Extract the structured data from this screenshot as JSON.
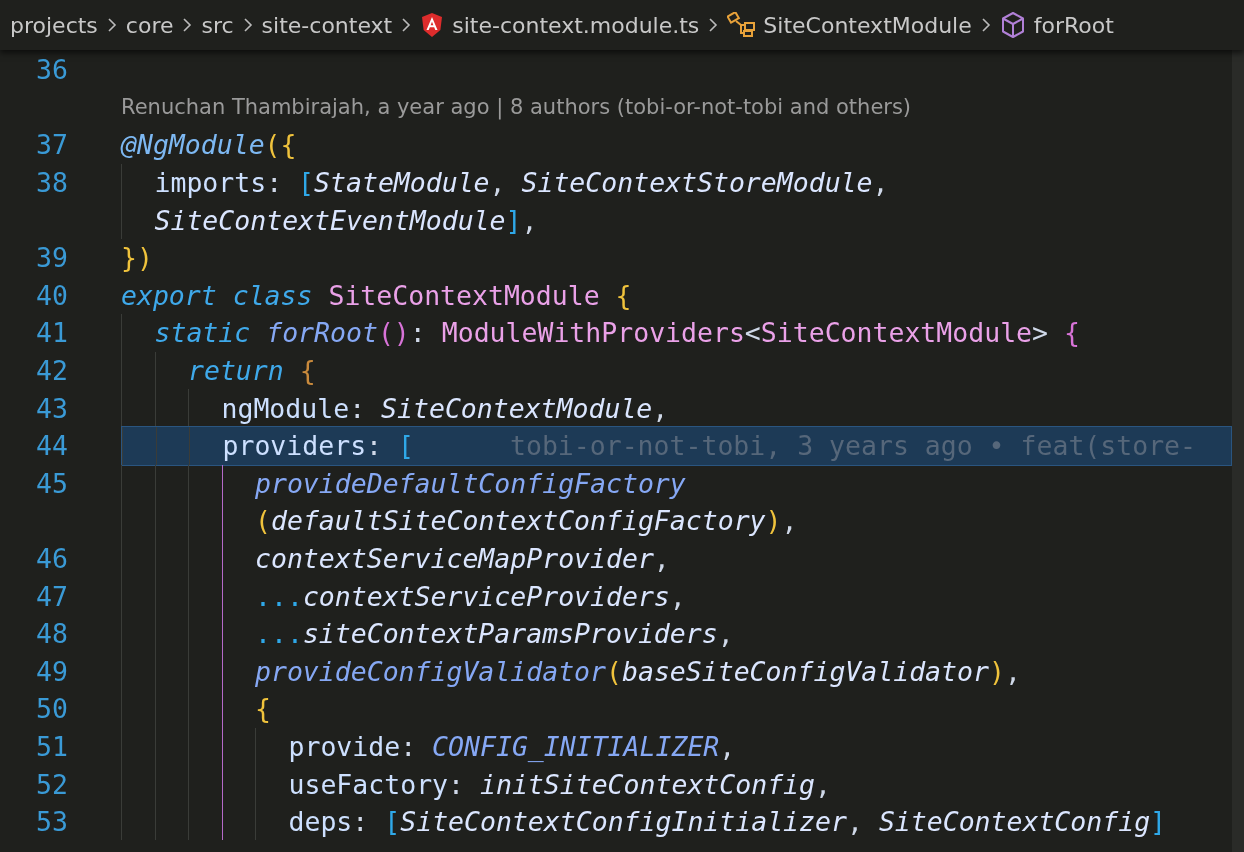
{
  "breadcrumb": [
    {
      "label": "projects",
      "kind": "folder"
    },
    {
      "label": "core",
      "kind": "folder"
    },
    {
      "label": "src",
      "kind": "folder"
    },
    {
      "label": "site-context",
      "kind": "folder"
    },
    {
      "label": "site-context.module.ts",
      "kind": "file"
    },
    {
      "label": "SiteContextModule",
      "kind": "class"
    },
    {
      "label": "forRoot",
      "kind": "method"
    }
  ],
  "lines": [
    {
      "number": "36"
    },
    {
      "kind": "codelens",
      "text": "Renuchan Thambirajah, a year ago | 8 authors (tobi-or-not-tobi and others)"
    },
    {
      "number": "37",
      "tokens": [
        {
          "text": "@NgModule",
          "kind": "deco"
        },
        {
          "text": "({",
          "kind": "br1"
        }
      ],
      "children": [
        {
          "number": "38",
          "tokens": [
            {
              "text": "imports",
              "kind": "prop"
            },
            {
              "text": ": ",
              "kind": "punc"
            },
            {
              "text": "[",
              "kind": "br3"
            },
            {
              "text": "StateModule",
              "kind": "id"
            },
            {
              "text": ", ",
              "kind": "punc"
            },
            {
              "text": "SiteContextStoreModule",
              "kind": "id"
            },
            {
              "text": ",",
              "kind": "punc"
            }
          ],
          "wrap": [
            {
              "text": "SiteContextEventModule",
              "kind": "id"
            },
            {
              "text": "]",
              "kind": "br3"
            },
            {
              "text": ",",
              "kind": "punc"
            }
          ]
        }
      ]
    },
    {
      "number": "39",
      "tokens": [
        {
          "text": "})",
          "kind": "br1"
        }
      ]
    },
    {
      "number": "40",
      "tokens": [
        {
          "text": "export class ",
          "kind": "kw"
        },
        {
          "text": "SiteContextModule",
          "kind": "cls"
        },
        {
          "text": " {",
          "kind": "br1"
        }
      ],
      "children": [
        {
          "number": "41",
          "tokens": [
            {
              "text": "static ",
              "kind": "kw"
            },
            {
              "text": "forRoot",
              "kind": "fn"
            },
            {
              "text": "()",
              "kind": "br2"
            },
            {
              "text": ": ",
              "kind": "punc"
            },
            {
              "text": "ModuleWithProviders",
              "kind": "cls"
            },
            {
              "text": "<",
              "kind": "punc"
            },
            {
              "text": "SiteContextModule",
              "kind": "cls"
            },
            {
              "text": "> ",
              "kind": "punc"
            },
            {
              "text": "{",
              "kind": "br2"
            }
          ],
          "children": [
            {
              "number": "42",
              "tokens": [
                {
                  "text": "return ",
                  "kind": "kw"
                },
                {
                  "text": "{",
                  "kind": "br4"
                }
              ],
              "children": [
                {
                  "number": "43",
                  "tokens": [
                    {
                      "text": "ngModule",
                      "kind": "prop"
                    },
                    {
                      "text": ": ",
                      "kind": "punc"
                    },
                    {
                      "text": "SiteContextModule",
                      "kind": "id"
                    },
                    {
                      "text": ",",
                      "kind": "punc"
                    }
                  ]
                },
                {
                  "number": "44",
                  "current": true,
                  "blame": "tobi-or-not-tobi, 3 years ago • feat(store-",
                  "tokens": [
                    {
                      "text": "providers",
                      "kind": "prop"
                    },
                    {
                      "text": ": ",
                      "kind": "punc"
                    },
                    {
                      "text": "[",
                      "kind": "br3"
                    }
                  ],
                  "children": [
                    {
                      "number": "45",
                      "tokens": [
                        {
                          "text": "provideDefaultConfigFactory",
                          "kind": "fn"
                        }
                      ],
                      "wrap": [
                        {
                          "text": "(",
                          "kind": "br1"
                        },
                        {
                          "text": "defaultSiteContextConfigFactory",
                          "kind": "id"
                        },
                        {
                          "text": ")",
                          "kind": "br1"
                        },
                        {
                          "text": ",",
                          "kind": "punc"
                        }
                      ]
                    },
                    {
                      "number": "46",
                      "tokens": [
                        {
                          "text": "contextServiceMapProvider",
                          "kind": "id"
                        },
                        {
                          "text": ",",
                          "kind": "punc"
                        }
                      ]
                    },
                    {
                      "number": "47",
                      "tokens": [
                        {
                          "text": "...",
                          "kind": "br3"
                        },
                        {
                          "text": "contextServiceProviders",
                          "kind": "id"
                        },
                        {
                          "text": ",",
                          "kind": "punc"
                        }
                      ]
                    },
                    {
                      "number": "48",
                      "tokens": [
                        {
                          "text": "...",
                          "kind": "br3"
                        },
                        {
                          "text": "siteContextParamsProviders",
                          "kind": "id"
                        },
                        {
                          "text": ",",
                          "kind": "punc"
                        }
                      ]
                    },
                    {
                      "number": "49",
                      "tokens": [
                        {
                          "text": "provideConfigValidator",
                          "kind": "fn"
                        },
                        {
                          "text": "(",
                          "kind": "br1"
                        },
                        {
                          "text": "baseSiteConfigValidator",
                          "kind": "id"
                        },
                        {
                          "text": ")",
                          "kind": "br1"
                        },
                        {
                          "text": ",",
                          "kind": "punc"
                        }
                      ]
                    },
                    {
                      "number": "50",
                      "tokens": [
                        {
                          "text": "{",
                          "kind": "br1"
                        }
                      ],
                      "children": [
                        {
                          "number": "51",
                          "tokens": [
                            {
                              "text": "provide",
                              "kind": "prop"
                            },
                            {
                              "text": ": ",
                              "kind": "punc"
                            },
                            {
                              "text": "CONFIG_INITIALIZER",
                              "kind": "fn"
                            },
                            {
                              "text": ",",
                              "kind": "punc"
                            }
                          ]
                        },
                        {
                          "number": "52",
                          "tokens": [
                            {
                              "text": "useFactory",
                              "kind": "prop"
                            },
                            {
                              "text": ": ",
                              "kind": "punc"
                            },
                            {
                              "text": "initSiteContextConfig",
                              "kind": "id"
                            },
                            {
                              "text": ",",
                              "kind": "punc"
                            }
                          ]
                        },
                        {
                          "number": "53",
                          "tokens": [
                            {
                              "text": "deps",
                              "kind": "prop"
                            },
                            {
                              "text": ": ",
                              "kind": "punc"
                            },
                            {
                              "text": "[",
                              "kind": "br3"
                            },
                            {
                              "text": "SiteContextConfigInitializer",
                              "kind": "id"
                            },
                            {
                              "text": ", ",
                              "kind": "punc"
                            },
                            {
                              "text": "SiteContextConfig",
                              "kind": "id"
                            },
                            {
                              "text": "]",
                              "kind": "br3"
                            }
                          ]
                        }
                      ]
                    }
                  ]
                }
              ]
            }
          ]
        }
      ]
    }
  ]
}
